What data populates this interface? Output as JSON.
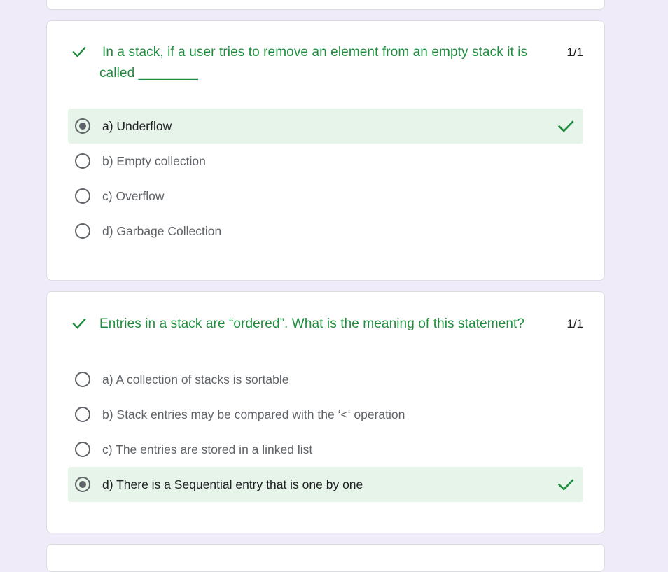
{
  "colors": {
    "correct": "#1e8e3e",
    "correct_bg": "#e6f4ea",
    "page_bg": "#efebf8",
    "text_muted": "#5f6368",
    "text_dark": "#202124"
  },
  "questions": [
    {
      "text": "In a stack, if a user tries to remove an element from an empty stack it is called ________",
      "score": "1/1",
      "status_icon": "check-icon",
      "options": [
        {
          "label": "a) Underflow",
          "selected": true,
          "correct": true
        },
        {
          "label": "b) Empty collection",
          "selected": false,
          "correct": false
        },
        {
          "label": "c) Overflow",
          "selected": false,
          "correct": false
        },
        {
          "label": "d) Garbage Collection",
          "selected": false,
          "correct": false
        }
      ]
    },
    {
      "text": "Entries in a stack are “ordered”. What is the meaning of this statement?",
      "score": "1/1",
      "status_icon": "check-icon",
      "options": [
        {
          "label": "a) A collection of stacks is sortable",
          "selected": false,
          "correct": false
        },
        {
          "label": "b) Stack entries may be compared with the ‘<‘ operation",
          "selected": false,
          "correct": false
        },
        {
          "label": "c) The entries are stored in a linked list",
          "selected": false,
          "correct": false
        },
        {
          "label": "d) There is a Sequential entry that is one by one",
          "selected": true,
          "correct": true
        }
      ]
    }
  ]
}
